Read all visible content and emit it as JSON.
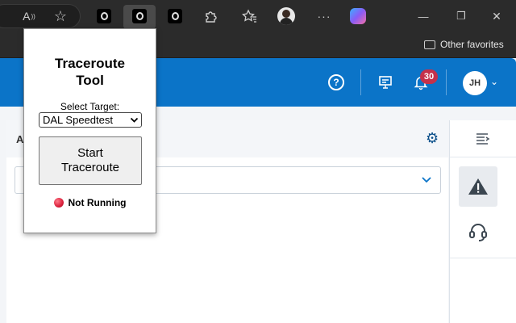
{
  "browser": {
    "toolbar": {
      "read_aloud_glyph": "A",
      "favorite_glyph": "☆",
      "extensions_icon": "puzzle-icon",
      "favorites_icon": "star-list-icon",
      "more_label": "···"
    },
    "window": {
      "minimize": "—",
      "restore": "❐",
      "close": "✕"
    },
    "favorites_bar": {
      "folder_label": "Other favorites"
    }
  },
  "popup": {
    "title": "Traceroute Tool",
    "select_label": "Select Target:",
    "selected_target": "DAL Speedtest",
    "button_label": "Start Traceroute",
    "status_text": "Not Running",
    "status_color": "#d91f3a"
  },
  "app": {
    "header_color": "#0b74c8",
    "help_glyph": "?",
    "notification_count": "30",
    "user_initials": "JH",
    "panel_title_visible": "A"
  }
}
